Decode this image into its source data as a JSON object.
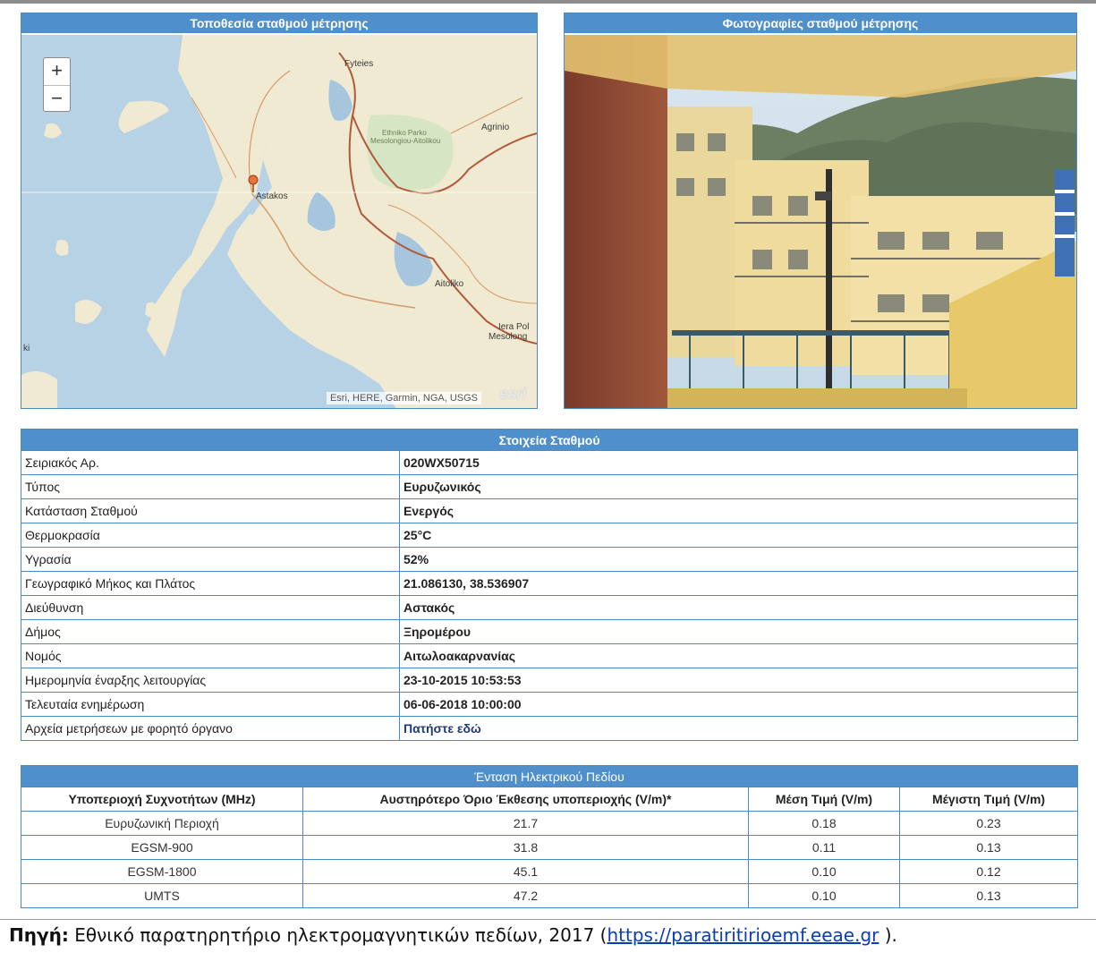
{
  "map_panel": {
    "title": "Τοποθεσία σταθμού μέτρησης",
    "zoom_in": "+",
    "zoom_out": "−",
    "labels": {
      "fyteies": "Fyteies",
      "agrinio": "Agrinio",
      "park_1": "Ethniko Parko",
      "park_2": "Mesolongiou-Aitolikou",
      "astakos": "Astakos",
      "aitoliko": "Aitoliko",
      "iera_1": "Iera Pol",
      "iera_2": "Mesolong",
      "ki": "ki"
    },
    "attribution": "Esri, HERE, Garmin, NGA, USGS",
    "logo": "esri"
  },
  "photo_panel": {
    "title": "Φωτογραφίες σταθμού μέτρησης"
  },
  "station": {
    "title": "Στοιχεία Σταθμού",
    "rows": [
      {
        "label": "Σειριακός Αρ.",
        "value": "020WX50715"
      },
      {
        "label": "Τύπος",
        "value": "Ευρυζωνικός"
      },
      {
        "label": "Κατάσταση Σταθμού",
        "value": "Ενεργός"
      },
      {
        "label": "Θερμοκρασία",
        "value": "25°C"
      },
      {
        "label": "Υγρασία",
        "value": "52%"
      },
      {
        "label": "Γεωγραφικό Μήκος και Πλάτος",
        "value": "21.086130, 38.536907"
      },
      {
        "label": "Διεύθυνση",
        "value": "Αστακός"
      },
      {
        "label": "Δήμος",
        "value": "Ξηρομέρου"
      },
      {
        "label": "Νομός",
        "value": "Αιτωλοακαρνανίας"
      },
      {
        "label": "Ημερομηνία έναρξης λειτουργίας",
        "value": "23-10-2015 10:53:53"
      },
      {
        "label": "Τελευταία ενημέρωση",
        "value": "06-06-2018 10:00:00"
      },
      {
        "label": "Αρχεία μετρήσεων με φορητό όργανο",
        "value": "Πατήστε εδώ"
      }
    ]
  },
  "field": {
    "title": "Ένταση Ηλεκτρικού Πεδίου",
    "columns": [
      "Υποπεριοχή Συχνοτήτων (MHz)",
      "Αυστηρότερο Όριο Έκθεσης υποπεριοχής (V/m)*",
      "Μέση Τιμή (V/m)",
      "Μέγιστη Τιμή (V/m)"
    ],
    "rows": [
      [
        "Ευρυζωνική Περιοχή",
        "21.7",
        "0.18",
        "0.23"
      ],
      [
        "EGSM-900",
        "31.8",
        "0.11",
        "0.13"
      ],
      [
        "EGSM-1800",
        "45.1",
        "0.10",
        "0.12"
      ],
      [
        "UMTS",
        "47.2",
        "0.10",
        "0.13"
      ]
    ]
  },
  "source": {
    "label": "Πηγή:",
    "text": " Εθνικό παρατηρητήριο ηλεκτρομαγνητικών πεδίων, 2017 (",
    "link": "https://paratiritirioemf.eeae.gr",
    "close": " )."
  }
}
